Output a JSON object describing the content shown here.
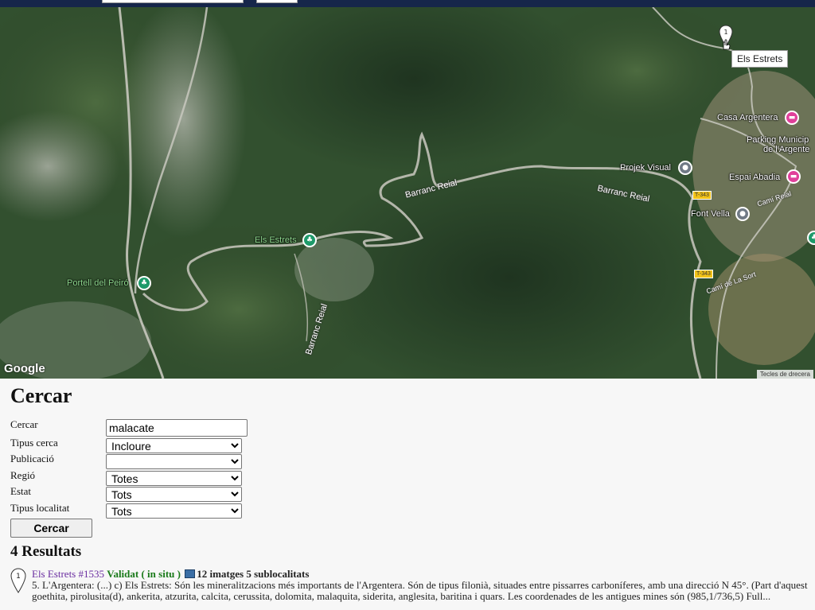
{
  "map": {
    "places": {
      "els_estrets_park": "Els Estrets",
      "portell_del_peiro": "Portell del Peiró",
      "casa_argentera": "Casa Argentera",
      "parking": "Parking Municip",
      "parking_2": "de l'Argente",
      "projek_visual": "Projek Visual",
      "espai_abadia": "Espai Abadia",
      "font_vella": "Font Vella"
    },
    "roads": {
      "barranc_reial_1": "Barranc Reial",
      "barranc_reial_2": "Barranc Reial",
      "barranc_reial_3": "Barranc Reial",
      "cami_reial": "Camí Reial",
      "cami_de_la_sort": "Camí de La Sort",
      "t343": "T-343"
    },
    "marker_number": "1",
    "tooltip": "Els Estrets",
    "google_logo": "Google",
    "shortcuts": "Tecles de drecera"
  },
  "form": {
    "title": "Cercar",
    "fields": {
      "cercar": {
        "label": "Cercar",
        "value": "malacate"
      },
      "tipus_cerca": {
        "label": "Tipus cerca",
        "value": "Incloure"
      },
      "publicacio": {
        "label": "Publicació",
        "value": ""
      },
      "regio": {
        "label": "Regió",
        "value": "Totes"
      },
      "estat": {
        "label": "Estat",
        "value": "Tots"
      },
      "tipus_localitat": {
        "label": "Tipus localitat",
        "value": "Tots"
      }
    },
    "button": "Cercar"
  },
  "results": {
    "title": "4 Resultats",
    "items": [
      {
        "pin_number": "1",
        "link": "Els Estrets #1535",
        "status": "Validat ( in situ )",
        "counts": "12 imatges 5 sublocalitats",
        "desc": "5. L'Argentera: (...) c) Els Estrets: Són les mineralitzacions més importants de l'Argentera. Són de tipus filonià, situades entre pissarres carboníferes, amb una direcció N 45°. (Part d'aquest goethita, pirolusita(d), ankerita, atzurita, calcita, cerussita, dolomita, malaquita, siderita, anglesita, baritina i quars. Les coordenades de les antigues mines són (985,1/736,5) Full..."
      }
    ]
  },
  "colors": {
    "topbar": "#16264a",
    "link": "#6a2da0",
    "validated": "#1a7a1a"
  }
}
